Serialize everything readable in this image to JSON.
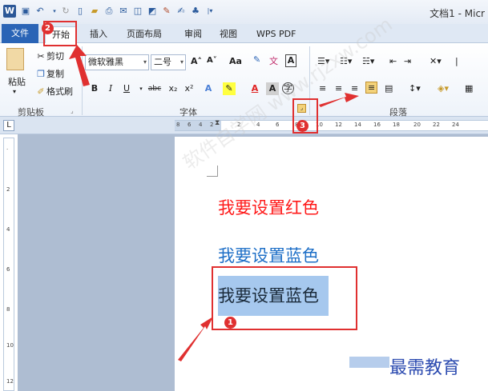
{
  "title": "文档1 - Micr",
  "tabs": {
    "file": "文件",
    "home": "开始",
    "insert": "插入",
    "layout": "页面布局",
    "review": "审阅",
    "view": "视图",
    "wps_pdf": "WPS PDF"
  },
  "clipboard": {
    "paste": "粘贴",
    "cut": "剪切",
    "copy": "复制",
    "format_painter": "格式刷",
    "group_label": "剪贴板"
  },
  "font": {
    "font_name": "微软雅黑",
    "font_size": "二号",
    "grow": "A˄",
    "shrink": "A˅",
    "change_case": "Aa",
    "bold": "B",
    "italic": "I",
    "underline": "U",
    "strike": "abc",
    "sub": "x₂",
    "sup": "x²",
    "group_label": "字体"
  },
  "paragraph": {
    "group_label": "段落"
  },
  "ruler_ticks": [
    "8",
    "6",
    "4",
    "2",
    "2",
    "4",
    "6",
    "8",
    "10",
    "12",
    "14",
    "16",
    "18",
    "20",
    "22",
    "24"
  ],
  "vruler_ticks": [
    "2",
    "4",
    "6",
    "8",
    "10",
    "12"
  ],
  "document": {
    "line1": "我要设置红色",
    "line2": "我要设置蓝色",
    "line3": "我要设置蓝色"
  },
  "badges": [
    "1",
    "2",
    "3"
  ],
  "watermark": "软件自学网 www.rjzxw.com",
  "brand": "最需教育",
  "colors": {
    "red_text": "#ff1a1a",
    "blue_text": "#1e6fc7",
    "selection": "#a6c8ee",
    "annotation": "#e03030"
  }
}
